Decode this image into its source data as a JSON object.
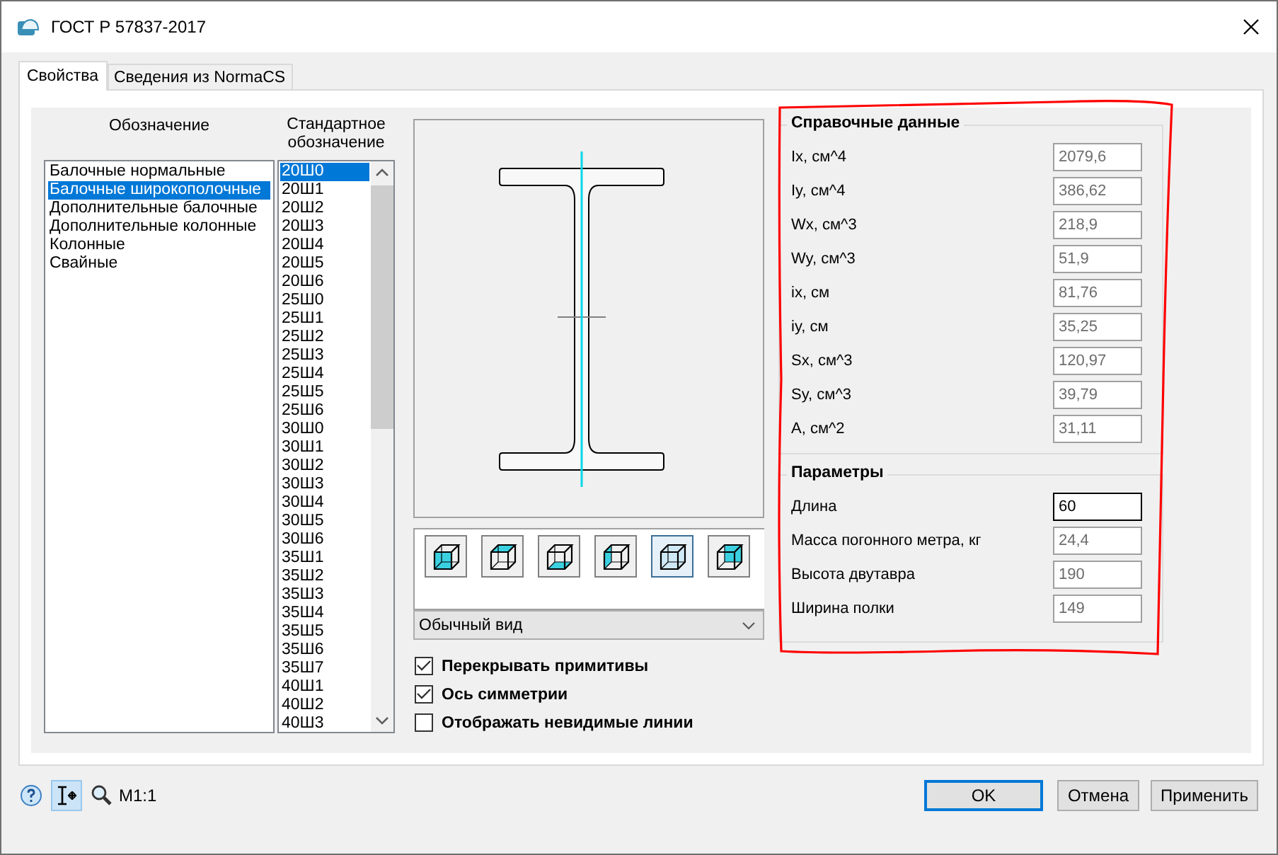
{
  "window": {
    "title": "ГОСТ Р 57837-2017"
  },
  "tabs": [
    {
      "label": "Свойства",
      "selected": true
    },
    {
      "label": "Сведения из NormaCS",
      "selected": false
    }
  ],
  "designation_list": {
    "header": "Обозначение",
    "items": [
      {
        "label": "Балочные нормальные",
        "selected": false
      },
      {
        "label": "Балочные широкополочные",
        "selected": true
      },
      {
        "label": "Дополнительные балочные",
        "selected": false
      },
      {
        "label": "Дополнительные колонные",
        "selected": false
      },
      {
        "label": "Колонные",
        "selected": false
      },
      {
        "label": "Свайные",
        "selected": false
      }
    ]
  },
  "standard_list": {
    "header": "Стандартное обозначение",
    "items": [
      {
        "label": "20Ш0",
        "selected": true
      },
      {
        "label": "20Ш1",
        "selected": false
      },
      {
        "label": "20Ш2",
        "selected": false
      },
      {
        "label": "20Ш3",
        "selected": false
      },
      {
        "label": "20Ш4",
        "selected": false
      },
      {
        "label": "20Ш5",
        "selected": false
      },
      {
        "label": "20Ш6",
        "selected": false
      },
      {
        "label": "25Ш0",
        "selected": false
      },
      {
        "label": "25Ш1",
        "selected": false
      },
      {
        "label": "25Ш2",
        "selected": false
      },
      {
        "label": "25Ш3",
        "selected": false
      },
      {
        "label": "25Ш4",
        "selected": false
      },
      {
        "label": "25Ш5",
        "selected": false
      },
      {
        "label": "25Ш6",
        "selected": false
      },
      {
        "label": "30Ш0",
        "selected": false
      },
      {
        "label": "30Ш1",
        "selected": false
      },
      {
        "label": "30Ш2",
        "selected": false
      },
      {
        "label": "30Ш3",
        "selected": false
      },
      {
        "label": "30Ш4",
        "selected": false
      },
      {
        "label": "30Ш5",
        "selected": false
      },
      {
        "label": "30Ш6",
        "selected": false
      },
      {
        "label": "35Ш1",
        "selected": false
      },
      {
        "label": "35Ш2",
        "selected": false
      },
      {
        "label": "35Ш3",
        "selected": false
      },
      {
        "label": "35Ш4",
        "selected": false
      },
      {
        "label": "35Ш5",
        "selected": false
      },
      {
        "label": "35Ш6",
        "selected": false
      },
      {
        "label": "35Ш7",
        "selected": false
      },
      {
        "label": "40Ш1",
        "selected": false
      },
      {
        "label": "40Ш2",
        "selected": false
      },
      {
        "label": "40Ш3",
        "selected": false
      }
    ]
  },
  "view_buttons": [
    {
      "kind": "front",
      "selected": false
    },
    {
      "kind": "top",
      "selected": false
    },
    {
      "kind": "bottom",
      "selected": false
    },
    {
      "kind": "left",
      "selected": false
    },
    {
      "kind": "all",
      "selected": true
    },
    {
      "kind": "back",
      "selected": false
    }
  ],
  "view_mode": {
    "value": "Обычный вид"
  },
  "options": [
    {
      "label": "Перекрывать примитивы",
      "checked": true
    },
    {
      "label": "Ось симметрии",
      "checked": true
    },
    {
      "label": "Отображать невидимые линии",
      "checked": false
    }
  ],
  "reference_data": {
    "title": "Справочные данные",
    "rows": [
      {
        "label": "Ix, см^4",
        "value": "2079,6",
        "disabled": true
      },
      {
        "label": "Iy, см^4",
        "value": "386,62",
        "disabled": true
      },
      {
        "label": "Wx, см^3",
        "value": "218,9",
        "disabled": true
      },
      {
        "label": "Wy, см^3",
        "value": "51,9",
        "disabled": true
      },
      {
        "label": "ix, см",
        "value": "81,76",
        "disabled": true
      },
      {
        "label": "iy, см",
        "value": "35,25",
        "disabled": true
      },
      {
        "label": "Sx, см^3",
        "value": "120,97",
        "disabled": true
      },
      {
        "label": "Sy, см^3",
        "value": "39,79",
        "disabled": true
      },
      {
        "label": "A, см^2",
        "value": "31,11",
        "disabled": true
      }
    ]
  },
  "parameters": {
    "title": "Параметры",
    "rows": [
      {
        "label": "Длина",
        "value": "60",
        "disabled": false
      },
      {
        "label": "Масса погонного метра, кг",
        "value": "24,4",
        "disabled": true
      },
      {
        "label": "Высота двутавра",
        "value": "190",
        "disabled": true
      },
      {
        "label": "Ширина полки",
        "value": "149",
        "disabled": true
      }
    ]
  },
  "status": {
    "scale": "M1:1"
  },
  "buttons": [
    {
      "label": "OK",
      "default": true
    },
    {
      "label": "Отмена",
      "default": false
    },
    {
      "label": "Применить",
      "default": false
    }
  ]
}
